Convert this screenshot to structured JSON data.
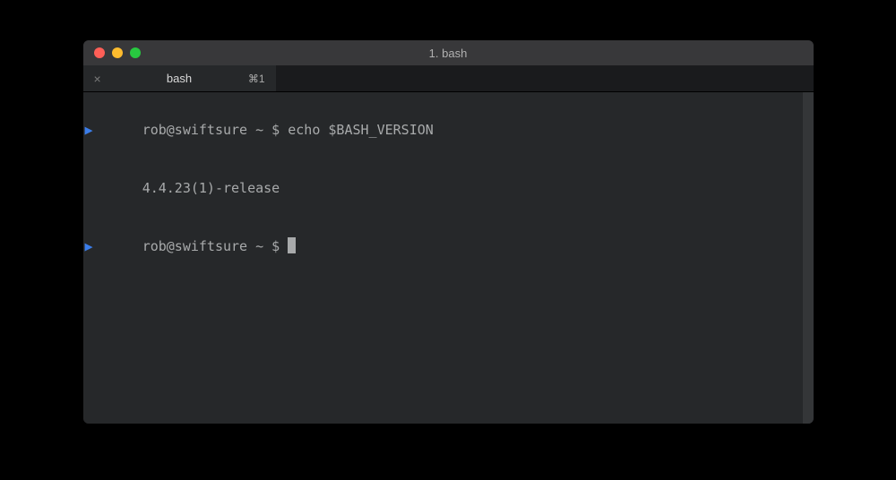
{
  "window": {
    "title": "1. bash"
  },
  "tab": {
    "title": "bash",
    "shortcut": "⌘1",
    "close_glyph": "×"
  },
  "terminal": {
    "lines": [
      {
        "marker": "▶",
        "prompt": "rob@swiftsure ~ $ ",
        "command": "echo $BASH_VERSION"
      },
      {
        "output": "4.4.23(1)-release"
      },
      {
        "marker": "▶",
        "prompt": "rob@swiftsure ~ $ ",
        "command": "",
        "cursor": true
      }
    ]
  }
}
